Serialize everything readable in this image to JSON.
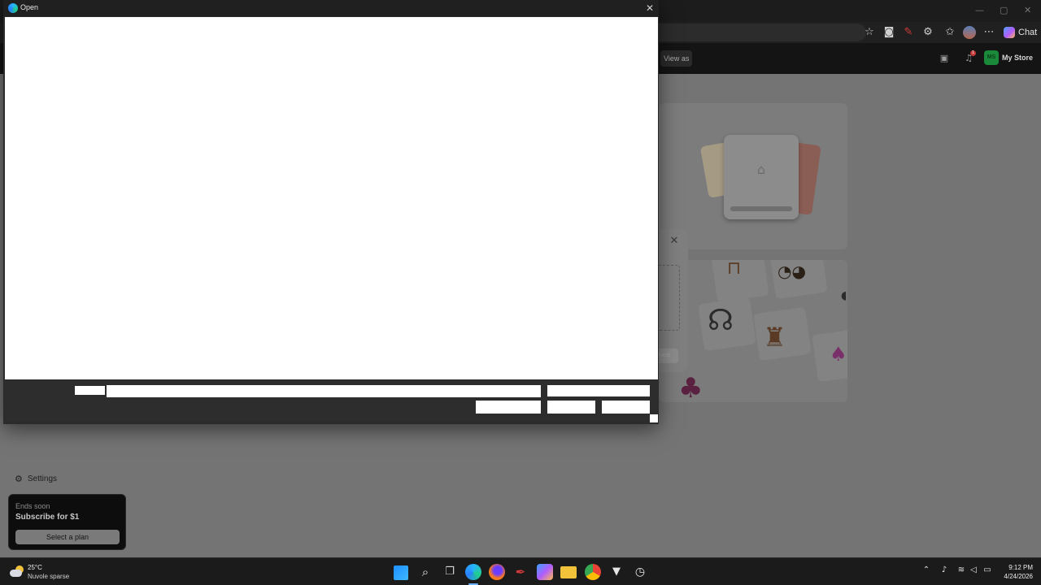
{
  "browser": {
    "window_controls": [
      "—",
      "▢",
      "✕"
    ],
    "toolbar_icons": [
      "star-icon",
      "camera-icon",
      "pen-icon",
      "extension-icon",
      "favorites-icon",
      "profile-icon",
      "more-icon"
    ],
    "chat_label": "Chat",
    "view_as_label": "View as",
    "store_avatar": "MS",
    "store_name": "My Store",
    "notification_count": "1"
  },
  "modal": {
    "close_glyph": "✕",
    "button_label": "Next"
  },
  "sidebar": {
    "settings_label": "Settings",
    "promo": {
      "subtitle": "Ends soon",
      "title": "Subscribe for $1",
      "button": "Select a plan"
    }
  },
  "dialog": {
    "title": "Open",
    "close_glyph": "✕"
  },
  "taskbar": {
    "weather_temp": "25°C",
    "weather_desc": "Nuvole sparse",
    "time": "9:12 PM",
    "date": "4/24/2026",
    "apps": [
      "start-icon",
      "search-icon",
      "task-view-icon",
      "edge-icon",
      "firefox-icon",
      "app-red-icon",
      "copilot-icon",
      "file-explorer-icon",
      "chrome-icon",
      "app-dark-icon",
      "app-clock-icon"
    ]
  },
  "colors": {
    "accent_green": "#1a8a3a",
    "taskbar": "#1b1b1b",
    "dialog_bg": "#2b2b2b"
  }
}
